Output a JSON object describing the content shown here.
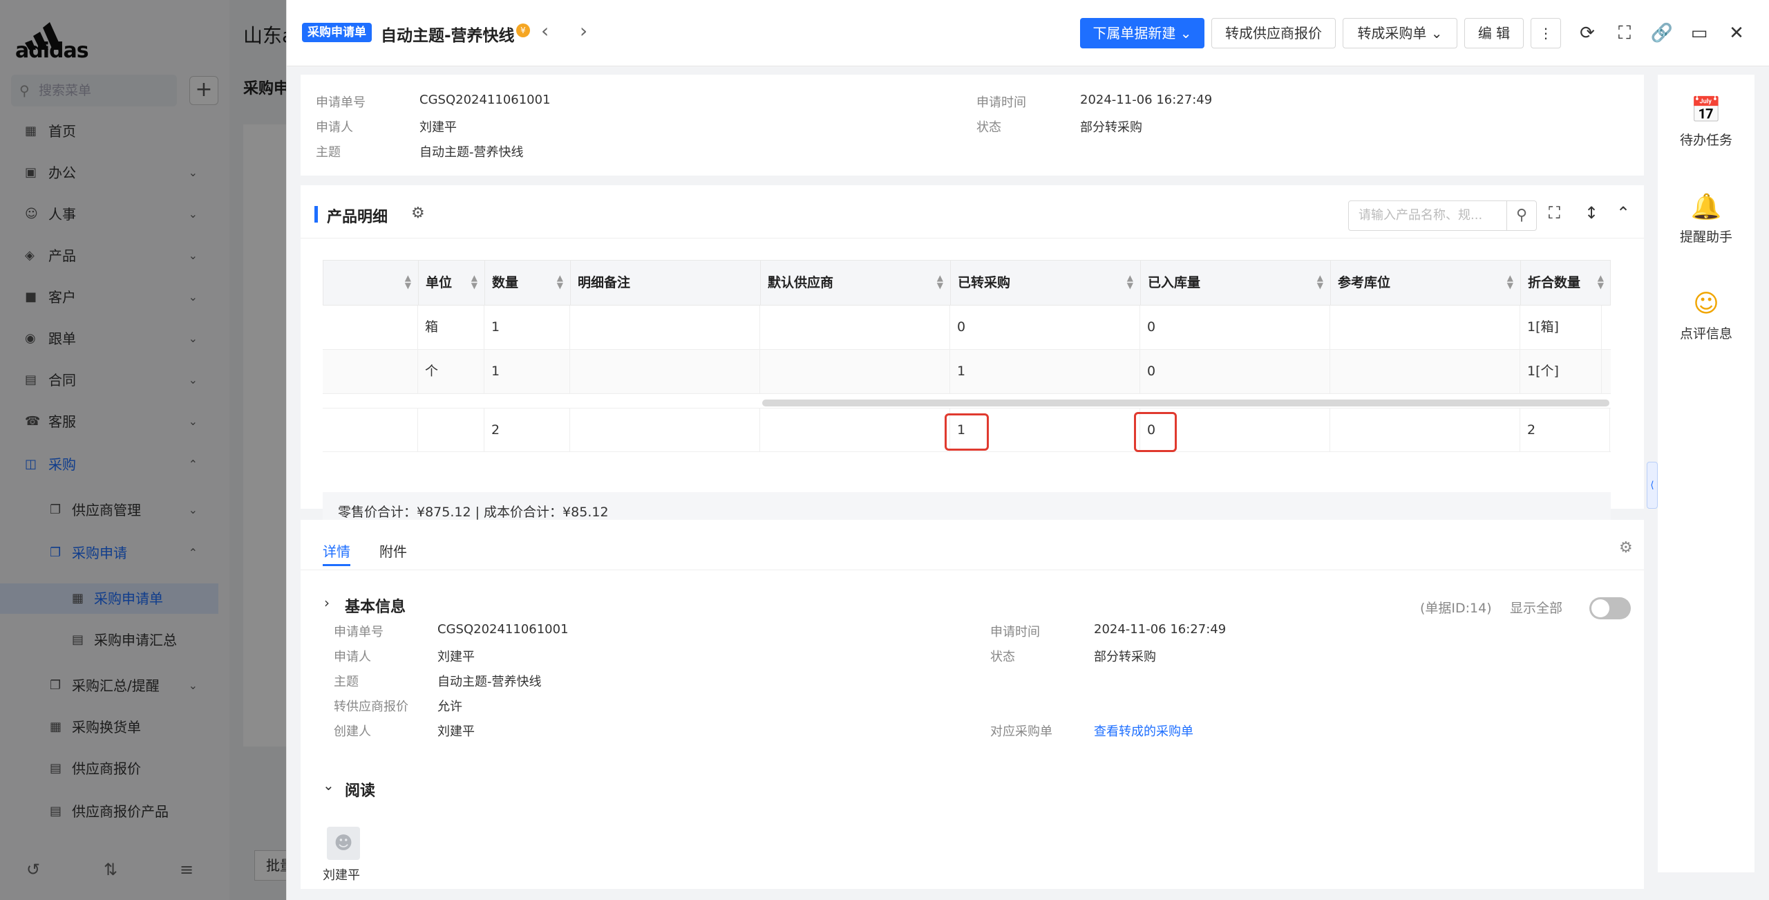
{
  "background_app": {
    "logo_text": "adidas",
    "company_title": "山东a",
    "page_title": "采购申",
    "batch_label": "批量",
    "search_placeholder": "搜索菜单",
    "menu": [
      {
        "label": "首页",
        "icon": "home-icon"
      },
      {
        "label": "办公",
        "icon": "office-icon"
      },
      {
        "label": "人事",
        "icon": "hr-icon"
      },
      {
        "label": "产品",
        "icon": "product-icon"
      },
      {
        "label": "客户",
        "icon": "customer-icon"
      },
      {
        "label": "跟单",
        "icon": "followup-icon"
      },
      {
        "label": "合同",
        "icon": "contract-icon"
      },
      {
        "label": "客服",
        "icon": "service-icon"
      },
      {
        "label": "采购",
        "icon": "purchase-icon"
      },
      {
        "label": "供应商管理",
        "icon": "supplier-icon"
      },
      {
        "label": "采购申请",
        "icon": "purchase-request-icon"
      },
      {
        "label": "采购申请单",
        "icon": "request-form-icon"
      },
      {
        "label": "采购申请汇总",
        "icon": "summary-icon"
      },
      {
        "label": "采购汇总/提醒",
        "icon": "reminder-icon"
      },
      {
        "label": "采购换货单",
        "icon": "exchange-icon"
      },
      {
        "label": "供应商报价",
        "icon": "quote-icon"
      },
      {
        "label": "供应商报价产品",
        "icon": "quote-product-icon"
      }
    ]
  },
  "drawer": {
    "type_tag": "采购申请单",
    "title": "自动主题-营养快线",
    "buttons": {
      "new_sub": "下属单据新建",
      "to_supplier_quote": "转成供应商报价",
      "to_purchase_order": "转成采购单",
      "edit": "编 辑"
    },
    "header_info": {
      "req_no_label": "申请单号",
      "req_no": "CGSQ202411061001",
      "applicant_label": "申请人",
      "applicant": "刘建平",
      "subject_label": "主题",
      "subject": "自动主题-营养快线",
      "req_time_label": "申请时间",
      "req_time": "2024-11-06 16:27:49",
      "status_label": "状态",
      "status": "部分转采购"
    },
    "products": {
      "title": "产品明细",
      "search_placeholder": "请输入产品名称、规...",
      "columns": [
        "单位",
        "数量",
        "明细备注",
        "默认供应商",
        "已转采购",
        "已入库量",
        "参考库位",
        "折合数量"
      ],
      "rows": [
        {
          "unit": "箱",
          "qty": "1",
          "note": "",
          "supplier": "",
          "converted": "0",
          "stocked": "0",
          "location": "",
          "equiv": "1[箱]"
        },
        {
          "unit": "个",
          "qty": "1",
          "note": "",
          "supplier": "",
          "converted": "1",
          "stocked": "0",
          "location": "",
          "equiv": "1[个]"
        }
      ],
      "summary": {
        "qty": "2",
        "converted": "1",
        "stocked": "0",
        "equiv": "2"
      },
      "totals_text": "零售价合计：¥875.12 |   成本价合计：¥85.12"
    },
    "tabs": [
      "详情",
      "附件"
    ],
    "basic_info": {
      "title": "基本信息",
      "doc_id": "(单据ID:14)",
      "show_all": "显示全部",
      "req_no_label": "申请单号",
      "req_no": "CGSQ202411061001",
      "applicant_label": "申请人",
      "applicant": "刘建平",
      "subject_label": "主题",
      "subject": "自动主题-营养快线",
      "supplier_quote_label": "转供应商报价",
      "supplier_quote": "允许",
      "creator_label": "创建人",
      "creator": "刘建平",
      "req_time_label": "申请时间",
      "req_time": "2024-11-06 16:27:49",
      "status_label": "状态",
      "status": "部分转采购",
      "po_label": "对应采购单",
      "po_link": "查看转成的采购单"
    },
    "read": {
      "title": "阅读",
      "reader": "刘建平"
    },
    "right_panel": [
      {
        "label": "待办任务",
        "icon": "calendar-task-icon",
        "color": "#19a55b"
      },
      {
        "label": "提醒助手",
        "icon": "bell-icon",
        "color": "#1e6fff"
      },
      {
        "label": "点评信息",
        "icon": "comment-icon",
        "color": "#f0a500"
      }
    ]
  }
}
